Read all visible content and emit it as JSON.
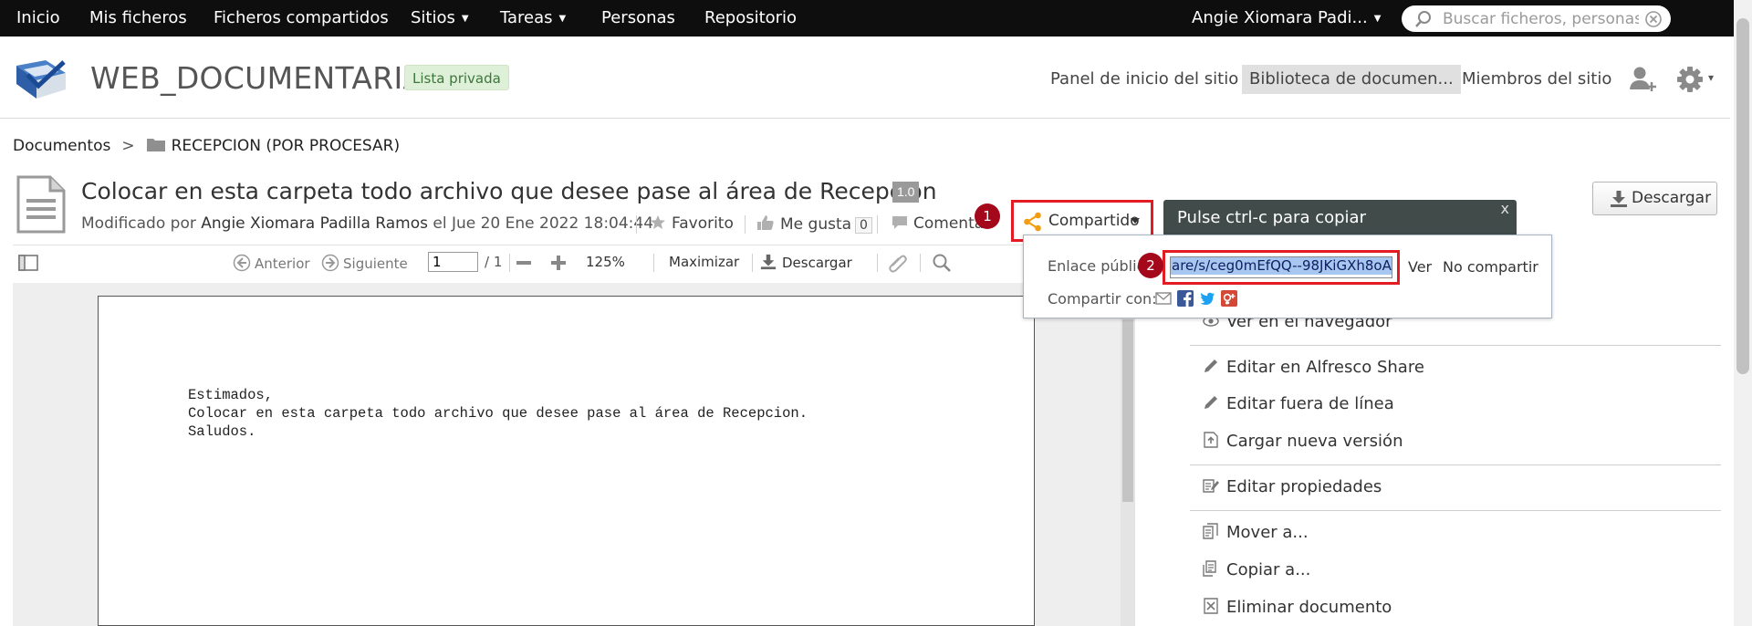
{
  "topnav": {
    "items": [
      {
        "label": "Inicio",
        "has_menu": false
      },
      {
        "label": "Mis ficheros",
        "has_menu": false
      },
      {
        "label": "Ficheros compartidos",
        "has_menu": false
      },
      {
        "label": "Sitios",
        "has_menu": true
      },
      {
        "label": "Tareas",
        "has_menu": true
      },
      {
        "label": "Personas",
        "has_menu": false
      },
      {
        "label": "Repositorio",
        "has_menu": false
      }
    ],
    "user": "Angie Xiomara Padi...",
    "caret": "▼",
    "search": {
      "placeholder": "Buscar ficheros, personas, siti",
      "value": ""
    }
  },
  "site": {
    "title": "WEB_DOCUMENTARIA",
    "visibility": "Lista privada",
    "nav": {
      "dashboard": "Panel de inicio del sitio",
      "library": "Biblioteca de documen...",
      "members": "Miembros del sitio"
    },
    "caret": "▾"
  },
  "breadcrumb": {
    "root": "Documentos",
    "separator": ">",
    "folder": "RECEPCION (POR PROCESAR)"
  },
  "document": {
    "title": "Colocar en esta carpeta todo archivo que desee pase al área de Recepcion",
    "version": "1.0",
    "modified_prefix": "Modificado por",
    "modified_by": "Angie Xiomara Padilla Ramos",
    "modified_on_prefix": "el",
    "modified_date": "Jue 20 Ene 2022 18:04:44",
    "favorite_label": "Favorito",
    "like_label": "Me gusta",
    "like_count": "0",
    "comment_label": "Comentar",
    "share_label": "Compartido",
    "download_label": "Descargar"
  },
  "steps": {
    "one": "1",
    "two": "2"
  },
  "toolbar": {
    "previous": "Anterior",
    "next": "Siguiente",
    "page": "1",
    "page_total": "/ 1",
    "zoom": "125%",
    "maximize": "Maximizar",
    "download": "Descargar"
  },
  "preview": {
    "text": "Estimados,\nColocar en esta carpeta todo archivo que desee pase al área de Recepcion.\nSaludos."
  },
  "share_popup": {
    "tooltip": "Pulse ctrl-c para copiar",
    "close": "x",
    "public_link_label": "Enlace público",
    "public_link_value": "are/s/ceg0mEfQQ--98JKiGXh8oA",
    "view_label": "Ver",
    "unshare_label": "No compartir",
    "share_with_label": "Compartir con:"
  },
  "actions": [
    {
      "label": "Ver en el navegador",
      "icon": "eye-icon"
    },
    {
      "label": "Editar en Alfresco Share",
      "icon": "pencil-icon"
    },
    {
      "label": "Editar fuera de línea",
      "icon": "pencil-icon"
    },
    {
      "label": "Cargar nueva versión",
      "icon": "upload-icon"
    },
    {
      "label": "Editar propiedades",
      "icon": "edit-properties-icon"
    },
    {
      "label": "Mover a...",
      "icon": "move-icon"
    },
    {
      "label": "Copiar a...",
      "icon": "copy-icon"
    },
    {
      "label": "Eliminar documento",
      "icon": "delete-icon"
    }
  ],
  "colors": {
    "topnav_bg": "#0e0e0e",
    "highlight_red": "#e31b23",
    "step_badge": "#a3081b",
    "tooltip_bg": "#404b4a",
    "share_icon_orange": "#f39c12",
    "selection_blue": "#a8c7f0"
  }
}
